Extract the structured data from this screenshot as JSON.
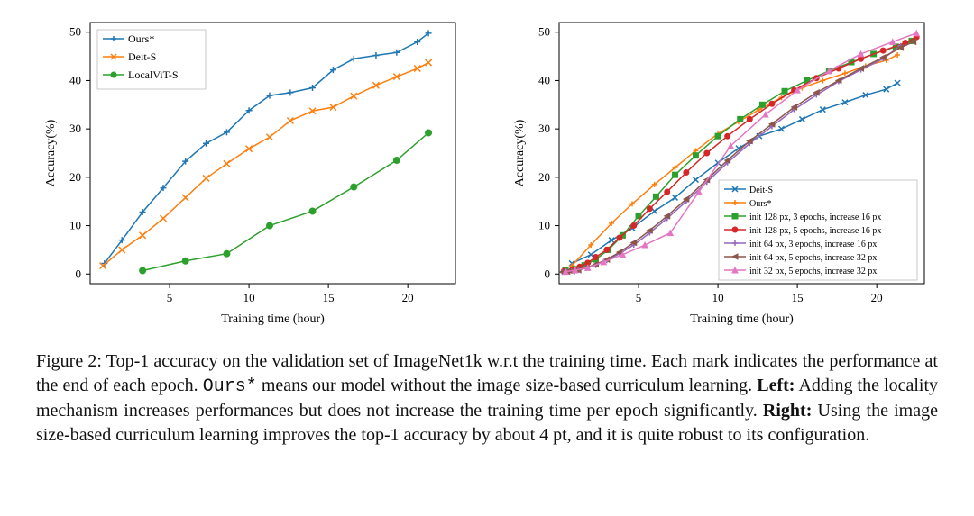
{
  "caption": {
    "prefix": "Figure 2: Top-1 accuracy on the validation set of ImageNet1k w.r.t the training time. Each mark indicates the performance at the end of each epoch. ",
    "ours": "Ours*",
    "afterOurs": " means our model without the image size-based curriculum learning. ",
    "leftLabel": "Left:",
    "leftText": " Adding the locality mechanism increases performances but does not increase the training time per epoch significantly. ",
    "rightLabel": "Right:",
    "rightText": " Using the image size-based curriculum learning improves the top-1 accuracy by about 4 pt, and it is quite robust to its configuration."
  },
  "chart_data": [
    {
      "type": "line",
      "title": "",
      "xlabel": "Training time (hour)",
      "ylabel": "Accuracy(%)",
      "xlim": [
        0,
        23
      ],
      "ylim": [
        -2,
        52
      ],
      "xticks": [
        5,
        10,
        15,
        20
      ],
      "yticks": [
        0,
        10,
        20,
        30,
        40,
        50
      ],
      "legend_position": "upper-left",
      "series": [
        {
          "name": "Ours*",
          "color": "#1f77b4",
          "marker": "plus",
          "x": [
            0.9,
            2.0,
            3.3,
            4.6,
            6.0,
            7.3,
            8.6,
            10.0,
            11.3,
            12.6,
            14.0,
            15.3,
            16.6,
            18.0,
            19.3,
            20.6,
            21.3
          ],
          "y": [
            2.2,
            7.0,
            12.8,
            17.8,
            23.3,
            27.0,
            29.3,
            33.8,
            36.9,
            37.5,
            38.5,
            42.2,
            44.5,
            45.2,
            45.8,
            48.0,
            49.8
          ]
        },
        {
          "name": "Deit-S",
          "color": "#ff7f0e",
          "marker": "x",
          "x": [
            0.8,
            2.0,
            3.3,
            4.6,
            6.0,
            7.3,
            8.6,
            10.0,
            11.3,
            12.6,
            14.0,
            15.3,
            16.6,
            18.0,
            19.3,
            20.6,
            21.3
          ],
          "y": [
            1.7,
            5.0,
            8.0,
            11.5,
            15.8,
            19.8,
            22.8,
            25.9,
            28.3,
            31.7,
            33.7,
            34.5,
            36.8,
            39.0,
            40.8,
            42.5,
            43.7
          ]
        },
        {
          "name": "LocalViT-S",
          "color": "#2ca02c",
          "marker": "circle",
          "x": [
            3.3,
            6.0,
            8.6,
            11.3,
            14.0,
            16.6,
            19.3,
            21.3
          ],
          "y": [
            0.7,
            2.7,
            4.2,
            10.0,
            13.0,
            18.0,
            23.5,
            29.2
          ]
        }
      ]
    },
    {
      "type": "line",
      "title": "",
      "xlabel": "Training time (hour)",
      "ylabel": "Accuracy(%)",
      "xlim": [
        0,
        23
      ],
      "ylim": [
        -2,
        52
      ],
      "xticks": [
        5,
        10,
        15,
        20
      ],
      "yticks": [
        0,
        10,
        20,
        30,
        40,
        50
      ],
      "legend_position": "lower-right",
      "series": [
        {
          "name": "Deit-S",
          "color": "#1f77b4",
          "marker": "x",
          "x": [
            0.8,
            2.0,
            3.3,
            4.6,
            6.0,
            7.3,
            8.6,
            10.0,
            11.3,
            12.6,
            14.0,
            15.3,
            16.6,
            18.0,
            19.3,
            20.6,
            21.3
          ],
          "y": [
            2.2,
            4.0,
            7.0,
            9.5,
            13.0,
            15.8,
            19.5,
            23.0,
            26.0,
            28.5,
            30.0,
            32.0,
            34.0,
            35.5,
            37.0,
            38.2,
            39.5
          ]
        },
        {
          "name": "Ours*",
          "color": "#ff7f0e",
          "marker": "plus",
          "x": [
            0.8,
            2.0,
            3.3,
            4.6,
            6.0,
            7.3,
            8.6,
            10.0,
            11.3,
            12.6,
            14.0,
            15.3,
            16.6,
            18.0,
            19.3,
            20.6,
            21.3
          ],
          "y": [
            1.7,
            6.0,
            10.5,
            14.5,
            18.5,
            22.0,
            25.5,
            29.0,
            31.5,
            34.0,
            36.5,
            38.5,
            40.0,
            41.5,
            43.0,
            44.2,
            45.3
          ]
        },
        {
          "name": "init 128 px, 3 epochs, increase 16 px",
          "color": "#2ca02c",
          "marker": "square",
          "x": [
            0.4,
            1.0,
            1.6,
            2.3,
            3.1,
            4.0,
            5.0,
            6.1,
            7.3,
            8.6,
            10.0,
            11.4,
            12.8,
            14.2,
            15.6,
            17.0,
            18.4,
            19.8,
            21.2,
            22.2
          ],
          "y": [
            0.8,
            1.0,
            1.8,
            3.0,
            5.0,
            8.0,
            12.0,
            16.0,
            20.5,
            24.5,
            28.5,
            32.0,
            35.0,
            37.8,
            40.0,
            42.0,
            43.8,
            45.5,
            47.0,
            48.2
          ]
        },
        {
          "name": "init 128 px, 5 epochs, increase 16 px",
          "color": "#d62728",
          "marker": "circle",
          "x": [
            0.3,
            0.8,
            1.3,
            1.8,
            2.3,
            3.0,
            3.8,
            4.7,
            5.7,
            6.8,
            8.0,
            9.3,
            10.6,
            12.0,
            13.4,
            14.8,
            16.2,
            17.6,
            19.0,
            20.4,
            21.8,
            22.5
          ],
          "y": [
            0.6,
            0.8,
            1.5,
            2.3,
            3.5,
            5.0,
            7.5,
            10.0,
            13.5,
            17.0,
            21.0,
            25.0,
            28.5,
            32.0,
            35.2,
            38.0,
            40.5,
            42.5,
            44.5,
            46.2,
            47.8,
            49.0
          ]
        },
        {
          "name": "init 64 px, 3 epochs, increase 16 px",
          "color": "#9467bd",
          "marker": "plus",
          "x": [
            0.2,
            0.5,
            0.8,
            1.2,
            1.7,
            2.3,
            3.0,
            3.8,
            4.7,
            5.7,
            6.8,
            8.0,
            9.3,
            10.6,
            12.0,
            13.4,
            14.8,
            16.2,
            17.6,
            19.0,
            20.4,
            21.5
          ],
          "y": [
            0.4,
            0.5,
            0.6,
            0.8,
            1.2,
            1.8,
            2.8,
            4.2,
            6.0,
            8.5,
            11.5,
            15.0,
            19.0,
            23.0,
            27.0,
            30.5,
            34.0,
            37.0,
            39.8,
            42.2,
            44.5,
            47.2
          ]
        },
        {
          "name": "init 64 px, 5 epochs, increase 32 px",
          "color": "#8c564b",
          "marker": "tri-left",
          "x": [
            0.2,
            0.5,
            0.8,
            1.2,
            1.7,
            2.3,
            3.0,
            3.8,
            4.7,
            5.7,
            6.8,
            8.0,
            9.3,
            10.6,
            12.0,
            13.4,
            14.8,
            16.2,
            17.6,
            19.0,
            20.4,
            21.5,
            22.3
          ],
          "y": [
            0.4,
            0.5,
            0.6,
            0.8,
            1.3,
            2.0,
            3.0,
            4.5,
            6.5,
            9.0,
            12.0,
            15.5,
            19.5,
            23.5,
            27.5,
            31.0,
            34.5,
            37.5,
            40.0,
            42.5,
            44.8,
            46.8,
            48.0
          ]
        },
        {
          "name": "init 32 px, 5 epochs, increase 32 px",
          "color": "#e377c2",
          "marker": "tri-up",
          "x": [
            0.4,
            1.0,
            1.8,
            2.8,
            4.0,
            5.4,
            7.0,
            8.8,
            10.8,
            13.0,
            15.0,
            17.0,
            19.0,
            21.0,
            22.5
          ],
          "y": [
            0.5,
            0.8,
            1.3,
            2.5,
            4.0,
            6.0,
            8.5,
            17.0,
            26.5,
            33.0,
            38.0,
            42.0,
            45.5,
            48.0,
            49.8
          ]
        }
      ]
    }
  ]
}
